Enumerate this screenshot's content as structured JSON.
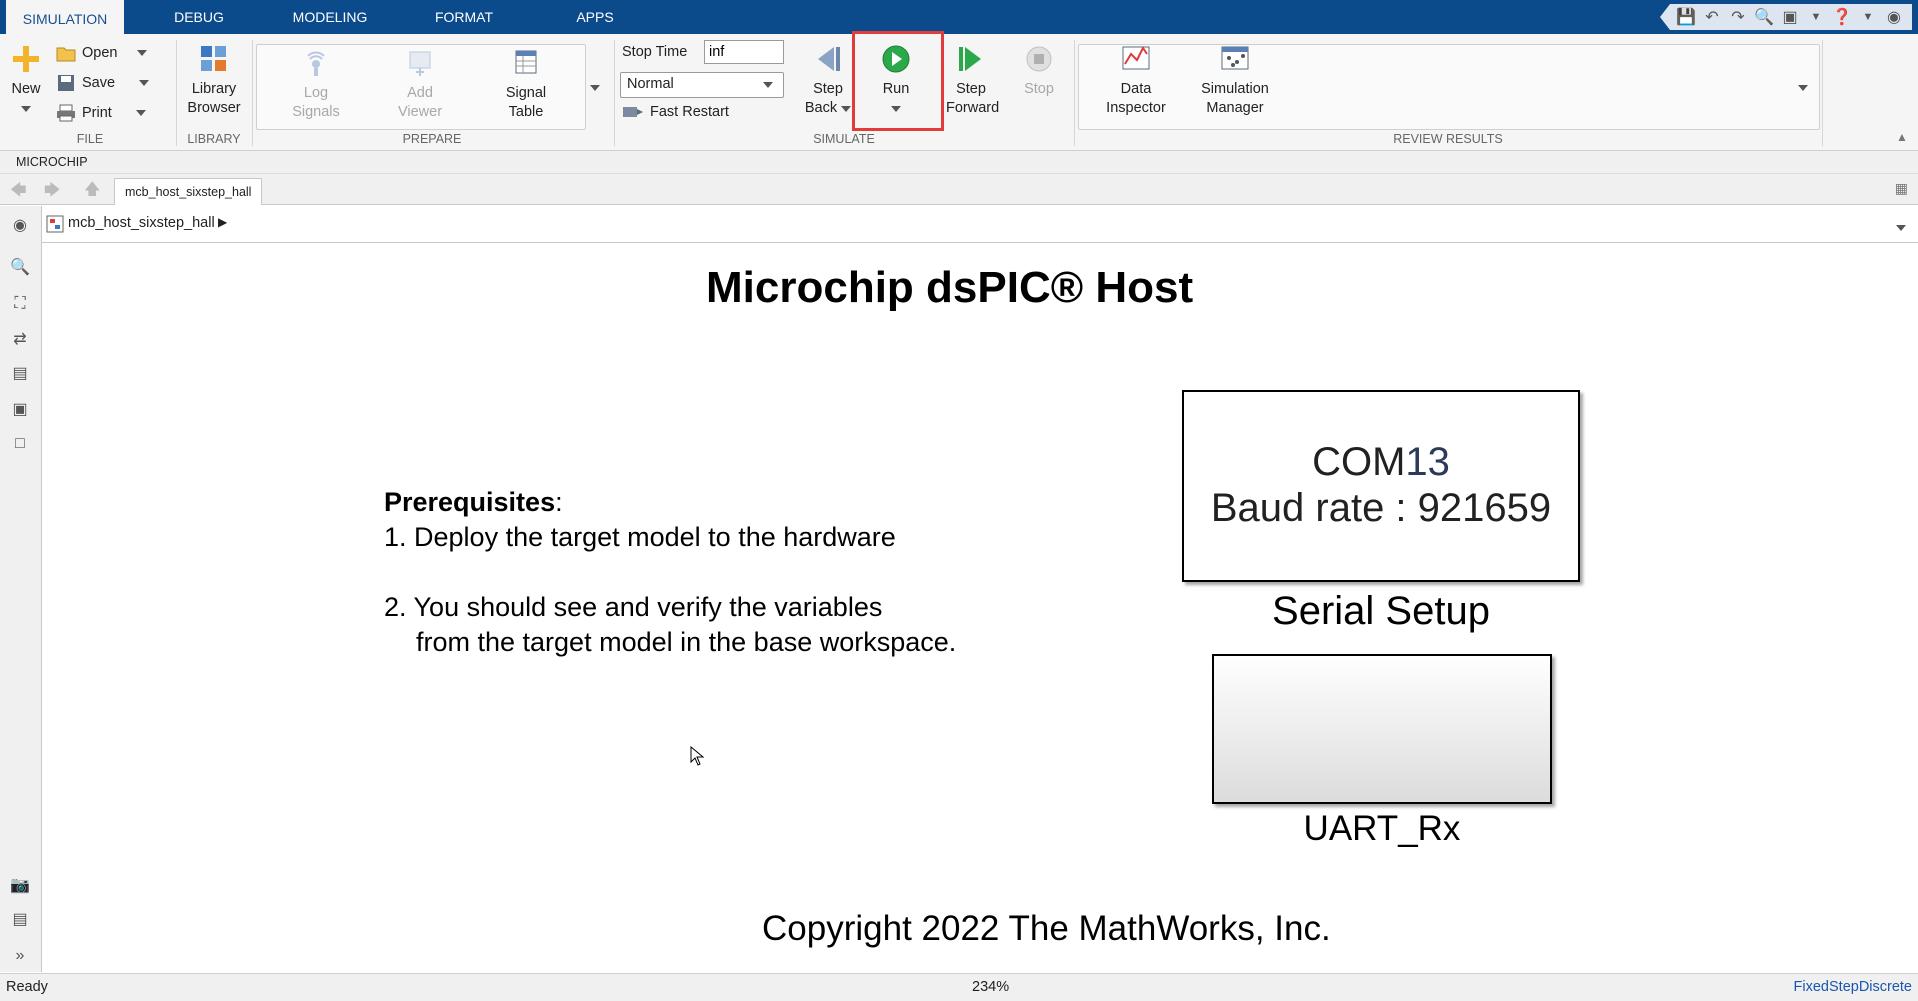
{
  "tabs": [
    "SIMULATION",
    "DEBUG",
    "MODELING",
    "FORMAT",
    "APPS"
  ],
  "ribbon": {
    "file": {
      "new": "New",
      "open": "Open",
      "save": "Save",
      "print": "Print",
      "title": "FILE"
    },
    "library": {
      "line1": "Library",
      "line2": "Browser",
      "title": "LIBRARY"
    },
    "prepare": {
      "log1": "Log",
      "log2": "Signals",
      "add1": "Add",
      "add2": "Viewer",
      "sig1": "Signal",
      "sig2": "Table",
      "title": "PREPARE"
    },
    "simulate": {
      "stop_time_label": "Stop Time",
      "stop_time_value": "inf",
      "mode": "Normal",
      "fast_restart": "Fast Restart",
      "stepback1": "Step",
      "stepback2": "Back",
      "run": "Run",
      "stepfwd1": "Step",
      "stepfwd2": "Forward",
      "stop": "Stop",
      "title": "SIMULATE"
    },
    "review": {
      "di1": "Data",
      "di2": "Inspector",
      "sm1": "Simulation",
      "sm2": "Manager",
      "title": "REVIEW RESULTS"
    }
  },
  "microchip_label": "MICROCHIP",
  "doc_tab": "mcb_host_sixstep_hall",
  "breadcrumb": "mcb_host_sixstep_hall",
  "canvas": {
    "title": "Microchip dsPIC® Host",
    "prereq_heading": "Prerequisites",
    "prereq_colon": ":",
    "step1": "1. Deploy the target model to the hardware",
    "step2a": "2. You should see and verify the variables",
    "step2b": "from the target model in the base workspace.",
    "com_prefix": "COM",
    "com_number": "13",
    "baud": "Baud rate : 921659",
    "serial_label": "Serial Setup",
    "uart_label": "UART_Rx",
    "copyright": "Copyright 2022 The MathWorks, Inc."
  },
  "status": {
    "left": "Ready",
    "zoom": "234%",
    "solver": "FixedStepDiscrete"
  },
  "colors": {
    "tabbar": "#0b4a8b",
    "highlight": "#e03c3c",
    "run_green": "#2aa84a"
  }
}
